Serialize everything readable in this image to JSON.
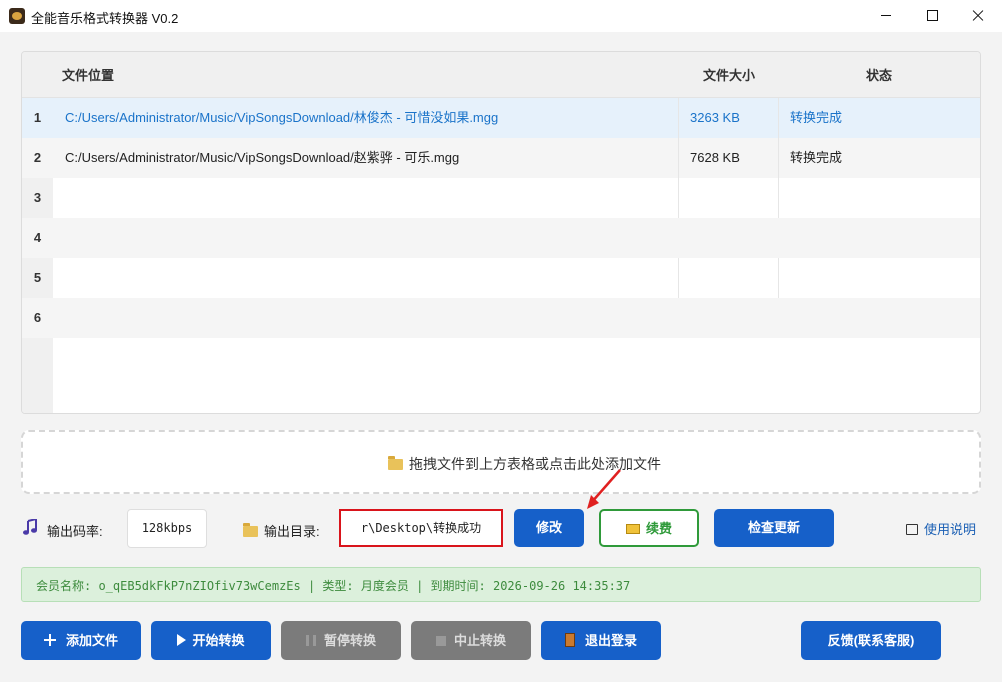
{
  "window": {
    "title": "全能音乐格式转换器 V0.2"
  },
  "table": {
    "headers": {
      "path": "文件位置",
      "size": "文件大小",
      "status": "状态"
    },
    "rows": [
      {
        "num": "1",
        "path": "C:/Users/Administrator/Music/VipSongsDownload/林俊杰 - 可惜没如果.mgg",
        "size": "3263 KB",
        "status": "转换完成"
      },
      {
        "num": "2",
        "path": "C:/Users/Administrator/Music/VipSongsDownload/赵紫骅 - 可乐.mgg",
        "size": "7628 KB",
        "status": "转换完成"
      },
      {
        "num": "3",
        "path": "",
        "size": "",
        "status": ""
      },
      {
        "num": "4",
        "path": "",
        "size": "",
        "status": ""
      },
      {
        "num": "5",
        "path": "",
        "size": "",
        "status": ""
      },
      {
        "num": "6",
        "path": "",
        "size": "",
        "status": ""
      }
    ]
  },
  "dropzone": {
    "text": "拖拽文件到上方表格或点击此处添加文件"
  },
  "settings": {
    "bitrate_label": "输出码率:",
    "bitrate_value": "128kbps",
    "outdir_label": "输出目录:",
    "outdir_value": "r\\Desktop\\转换成功",
    "modify_label": "修改",
    "renew_label": "续费",
    "check_update_label": "检查更新",
    "help_label": "使用说明"
  },
  "member": {
    "info": "会员名称: o_qEB5dkFkP7nZIOfiv73wCemzEs | 类型: 月度会员 | 到期时间: 2026-09-26 14:35:37"
  },
  "actions": {
    "add_file": "添加文件",
    "start": "开始转换",
    "pause": "暂停转换",
    "stop": "中止转换",
    "logout": "退出登录",
    "feedback": "反馈(联系客服)"
  },
  "colors": {
    "accent": "#1660c9",
    "success": "#2f9a3a",
    "highlight": "#d9141b"
  }
}
